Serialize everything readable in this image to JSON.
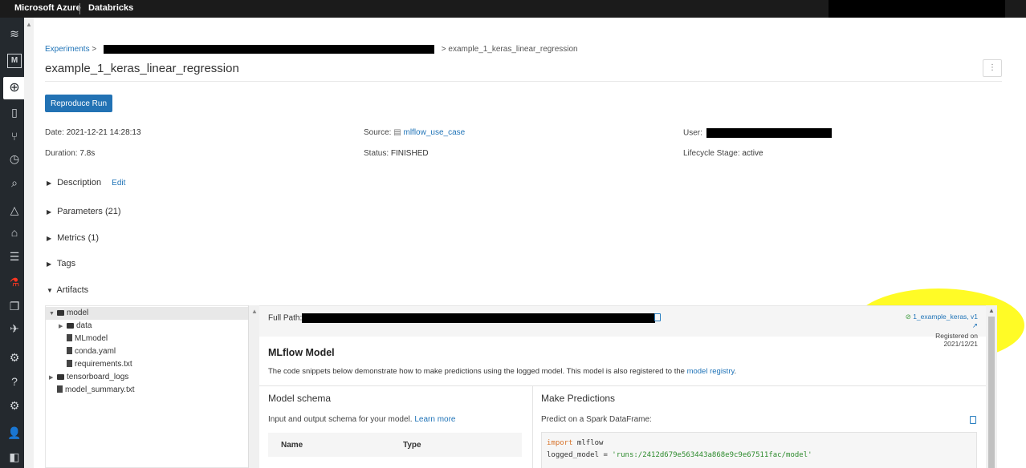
{
  "topbar": {
    "brand": "Microsoft Azure",
    "product": "Databricks"
  },
  "breadcrumb": {
    "root": "Experiments",
    "sep": ">",
    "current": "example_1_keras_linear_regression"
  },
  "page": {
    "title": "example_1_keras_linear_regression",
    "kebab": "⋮"
  },
  "actions": {
    "reproduce": "Reproduce Run"
  },
  "meta": {
    "date_label": "Date:",
    "date_value": "2021-12-21 14:28:13",
    "duration_label": "Duration:",
    "duration_value": "7.8s",
    "source_label": "Source:",
    "source_value": "mlflow_use_case",
    "status_label": "Status:",
    "status_value": "FINISHED",
    "user_label": "User:",
    "lifecycle_label": "Lifecycle Stage:",
    "lifecycle_value": "active"
  },
  "sections": {
    "description": "Description",
    "edit": "Edit",
    "parameters": "Parameters (21)",
    "metrics": "Metrics (1)",
    "tags": "Tags",
    "artifacts": "Artifacts"
  },
  "tree": {
    "model": "model",
    "data": "data",
    "mlmodel": "MLmodel",
    "conda": "conda.yaml",
    "requirements": "requirements.txt",
    "tensorboard": "tensorboard_logs",
    "summary": "model_summary.txt"
  },
  "detail": {
    "fullpath_label": "Full Path:",
    "registered_link": "1_example_keras, v1",
    "registered_on": "Registered on 2021/12/21",
    "mlflow_title": "MLflow Model",
    "mlflow_desc": "The code snippets below demonstrate how to make predictions using the logged model. This model is also registered to the",
    "mlflow_link": "model registry",
    "mlflow_period": ".",
    "schema_title": "Model schema",
    "schema_desc": "Input and output schema for your model.",
    "schema_link": "Learn more",
    "col_name": "Name",
    "col_type": "Type",
    "predict_title": "Make Predictions",
    "predict_desc": "Predict on a Spark DataFrame:",
    "code_kw": "import",
    "code_mod": " mlflow",
    "code_var": "logged_model = ",
    "code_str": "'runs:/2412d679e563443a868e9c9e67511fac/model'"
  },
  "colors": {
    "accent": "#2272b4",
    "link": "#1f73b7",
    "highlight": "#fffa00"
  }
}
